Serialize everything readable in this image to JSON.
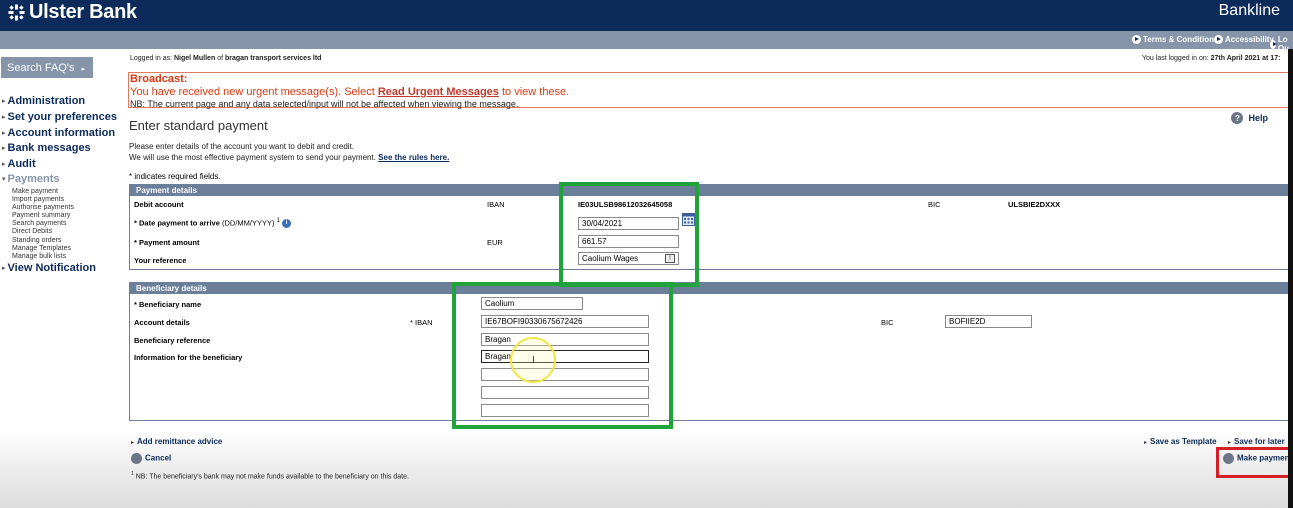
{
  "header": {
    "brand": "Ulster Bank",
    "product": "Bankline",
    "links": [
      "Terms & Conditions",
      "Accessibility",
      "Lo Ou"
    ]
  },
  "session": {
    "logged_in_prefix": "Logged in as:",
    "user": "Nigel Mullen",
    "of": "of",
    "company": "bragan transport services ltd",
    "last_login_prefix": "You last logged in on:",
    "last_login": "27th April 2021 at 17:"
  },
  "sidebar": {
    "faq_label": "Search FAQ's",
    "sections": [
      "Administration",
      "Set your preferences",
      "Account information",
      "Bank messages",
      "Audit"
    ],
    "payments_label": "Payments",
    "payment_items": [
      "Make payment",
      "Import payments",
      "Authorise payments",
      "Payment summary",
      "Search payments",
      "Direct Debits",
      "Standing orders",
      "Manage Templates",
      "Manage bulk lists"
    ],
    "view_notification": "View Notification"
  },
  "broadcast": {
    "title": "Broadcast:",
    "msg_before": "You have received new urgent message(s). Select",
    "msg_link": "Read Urgent Messages",
    "msg_after": "to view these.",
    "nb": "NB: The current page and any data selected/input will not be affected when viewing the message."
  },
  "page": {
    "title": "Enter standard payment",
    "help": "Help",
    "intro1": "Please enter details of the account you want to debit and credit.",
    "intro2": "We will use the most effective payment system to send your payment.",
    "rules_link": "See the rules here.",
    "required_note": "* indicates required fields."
  },
  "payment_details": {
    "title": "Payment details",
    "debit_label": "Debit account",
    "iban_label": "IBAN",
    "iban": "IE03ULSB98612032645058",
    "bic_label": "BIC",
    "bic": "ULSBIE2DXXX",
    "date_label": "Date payment to arrive",
    "date_format": "(DD/MM/YYYY)",
    "date_sup": "1",
    "date_value": "30/04/2021",
    "amount_label": "Payment amount",
    "currency": "EUR",
    "amount_value": "661.57",
    "reference_label": "Your reference",
    "reference_value": "Caolium Wages"
  },
  "beneficiary": {
    "title": "Beneficiary details",
    "name_label": "Beneficiary name",
    "name_value": "Caolium",
    "account_label": "Account details",
    "iban_label": "IBAN",
    "iban_value": "IE67BOFI90330675672426",
    "bic_label": "BIC",
    "bic_value": "BOFIIE2D",
    "ref_label": "Beneficiary reference",
    "ref_value": "Bragan",
    "info_label": "Information for the beneficiary",
    "info_values": [
      "Bragan",
      "",
      "",
      ""
    ]
  },
  "footer": {
    "remittance": "Add remittance advice",
    "save_template": "Save as Template",
    "save_later": "Save for later",
    "cancel": "Cancel",
    "make_payment": "Make paymen",
    "note_sup": "1",
    "note": "NB: The beneficiary's bank may not make funds available to the beneficiary on this date."
  },
  "colors": {
    "brand_navy": "#0c2b5a",
    "highlight_green": "#1fa33a",
    "highlight_red": "#d41f26",
    "alert_red": "#d63a12"
  }
}
